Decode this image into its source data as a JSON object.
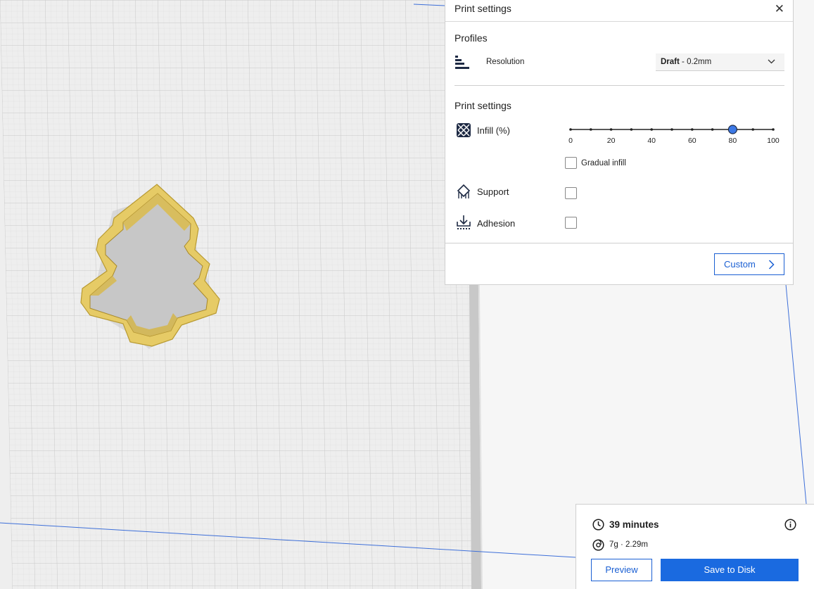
{
  "panel": {
    "title": "Print settings",
    "close_icon": "close-icon",
    "profiles_heading": "Profiles",
    "resolution": {
      "label": "Resolution",
      "value_bold": "Draft",
      "value_rest": " - 0.2mm",
      "icon": "resolution-bars-icon"
    },
    "print_settings_heading": "Print settings",
    "infill": {
      "label": "Infill (%)",
      "icon": "infill-pattern-icon",
      "value_percent": 80,
      "tick_labels": [
        "0",
        "20",
        "40",
        "60",
        "80",
        "100"
      ],
      "gradual_label": "Gradual infill",
      "gradual_checked": false
    },
    "support": {
      "label": "Support",
      "checked": false,
      "icon": "support-icon"
    },
    "adhesion": {
      "label": "Adhesion",
      "checked": false,
      "icon": "adhesion-icon"
    },
    "custom_button": "Custom"
  },
  "estimate": {
    "time": "39 minutes",
    "material": "7g · 2.29m",
    "time_icon": "clock-icon",
    "material_icon": "spool-icon",
    "info_icon": "info-icon",
    "preview_button": "Preview",
    "save_button": "Save to Disk"
  },
  "colors": {
    "accent": "#1a5fd3",
    "save_button": "#1a6ae0",
    "model_yellow": "#e9cf6c",
    "model_edge": "#bc9f36",
    "build_plate": "#eeeeee",
    "grid_line": "#c9c9c9"
  }
}
